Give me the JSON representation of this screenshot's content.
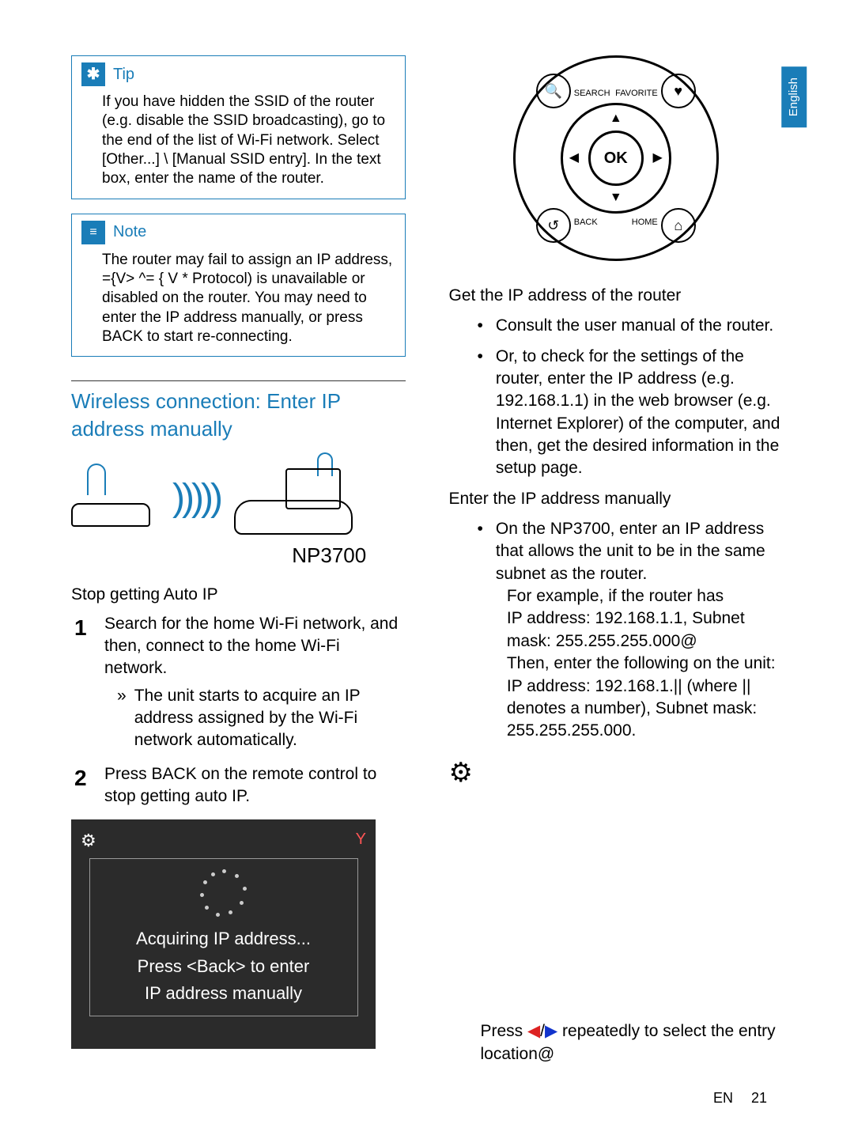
{
  "lang_tab": "English",
  "tip": {
    "label": "Tip",
    "body": "If you have hidden the SSID of the router (e.g. disable the SSID broadcasting), go to the end of the list of Wi-Fi network. Select [Other...] \\ [Manual SSID entry]. In the text box, enter the name of the router."
  },
  "note": {
    "label": "Note",
    "body": "The router may fail to assign an IP address, ={V> ^=       {    V   *   Protocol) is unavailable or disabled on the router. You may need to enter the IP address manually, or press BACK to start re-connecting."
  },
  "section_title": "Wireless connection: Enter IP address manually",
  "device_label": "NP3700",
  "stop_auto_ip_head": "Stop getting Auto IP",
  "step1": "Search for the home Wi-Fi network, and then, connect to the home Wi-Fi network.",
  "step1_sub": "The unit starts to acquire an IP address assigned by the Wi-Fi network automatically.",
  "step2": "Press BACK on the remote control to stop getting auto IP.",
  "screen": {
    "line1": "Acquiring IP address...",
    "line2": "Press <Back> to enter",
    "line3": "IP address manually"
  },
  "remote": {
    "ok": "OK",
    "search": "SEARCH",
    "favorite": "FAVORITE",
    "back": "BACK",
    "home": "HOME"
  },
  "get_ip_head": "Get the IP address of the router",
  "get_ip_b1": "Consult the user manual of the router.",
  "get_ip_b2": "Or, to check for the settings of the router, enter the IP address (e.g. 192.168.1.1) in the web browser (e.g. Internet Explorer) of the computer, and then, get the desired information in the setup page.",
  "enter_ip_head": "Enter the IP address manually",
  "enter_ip_b1": "On the NP3700, enter an IP address that allows the unit to be in the same subnet as the router.",
  "enter_ip_b2": "For example, if the router has",
  "enter_ip_b3": "IP address: 192.168.1.1, Subnet mask: 255.255.255.000@",
  "enter_ip_b4": "Then, enter the following on the unit: IP address: 192.168.1.|| (where || denotes a number), Subnet mask: 255.255.255.000.",
  "press_arrows": "Press ◀/▶ repeatedly to select the entry location@",
  "footer_lang": "EN",
  "footer_page": "21"
}
